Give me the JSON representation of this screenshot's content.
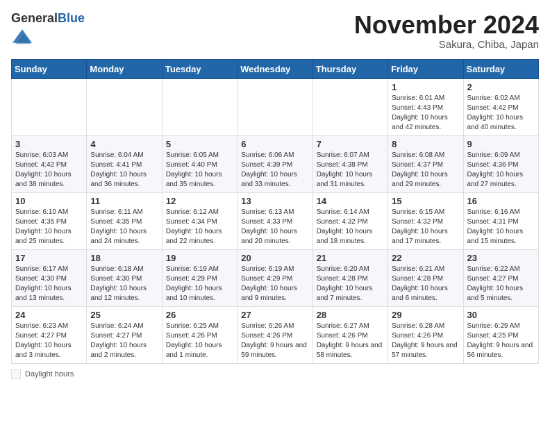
{
  "header": {
    "logo_general": "General",
    "logo_blue": "Blue",
    "month_title": "November 2024",
    "subtitle": "Sakura, Chiba, Japan"
  },
  "weekdays": [
    "Sunday",
    "Monday",
    "Tuesday",
    "Wednesday",
    "Thursday",
    "Friday",
    "Saturday"
  ],
  "footer": {
    "legend_label": "Daylight hours"
  },
  "weeks": [
    [
      {
        "day": "",
        "info": ""
      },
      {
        "day": "",
        "info": ""
      },
      {
        "day": "",
        "info": ""
      },
      {
        "day": "",
        "info": ""
      },
      {
        "day": "",
        "info": ""
      },
      {
        "day": "1",
        "info": "Sunrise: 6:01 AM\nSunset: 4:43 PM\nDaylight: 10 hours and 42 minutes."
      },
      {
        "day": "2",
        "info": "Sunrise: 6:02 AM\nSunset: 4:42 PM\nDaylight: 10 hours and 40 minutes."
      }
    ],
    [
      {
        "day": "3",
        "info": "Sunrise: 6:03 AM\nSunset: 4:42 PM\nDaylight: 10 hours and 38 minutes."
      },
      {
        "day": "4",
        "info": "Sunrise: 6:04 AM\nSunset: 4:41 PM\nDaylight: 10 hours and 36 minutes."
      },
      {
        "day": "5",
        "info": "Sunrise: 6:05 AM\nSunset: 4:40 PM\nDaylight: 10 hours and 35 minutes."
      },
      {
        "day": "6",
        "info": "Sunrise: 6:06 AM\nSunset: 4:39 PM\nDaylight: 10 hours and 33 minutes."
      },
      {
        "day": "7",
        "info": "Sunrise: 6:07 AM\nSunset: 4:38 PM\nDaylight: 10 hours and 31 minutes."
      },
      {
        "day": "8",
        "info": "Sunrise: 6:08 AM\nSunset: 4:37 PM\nDaylight: 10 hours and 29 minutes."
      },
      {
        "day": "9",
        "info": "Sunrise: 6:09 AM\nSunset: 4:36 PM\nDaylight: 10 hours and 27 minutes."
      }
    ],
    [
      {
        "day": "10",
        "info": "Sunrise: 6:10 AM\nSunset: 4:35 PM\nDaylight: 10 hours and 25 minutes."
      },
      {
        "day": "11",
        "info": "Sunrise: 6:11 AM\nSunset: 4:35 PM\nDaylight: 10 hours and 24 minutes."
      },
      {
        "day": "12",
        "info": "Sunrise: 6:12 AM\nSunset: 4:34 PM\nDaylight: 10 hours and 22 minutes."
      },
      {
        "day": "13",
        "info": "Sunrise: 6:13 AM\nSunset: 4:33 PM\nDaylight: 10 hours and 20 minutes."
      },
      {
        "day": "14",
        "info": "Sunrise: 6:14 AM\nSunset: 4:32 PM\nDaylight: 10 hours and 18 minutes."
      },
      {
        "day": "15",
        "info": "Sunrise: 6:15 AM\nSunset: 4:32 PM\nDaylight: 10 hours and 17 minutes."
      },
      {
        "day": "16",
        "info": "Sunrise: 6:16 AM\nSunset: 4:31 PM\nDaylight: 10 hours and 15 minutes."
      }
    ],
    [
      {
        "day": "17",
        "info": "Sunrise: 6:17 AM\nSunset: 4:30 PM\nDaylight: 10 hours and 13 minutes."
      },
      {
        "day": "18",
        "info": "Sunrise: 6:18 AM\nSunset: 4:30 PM\nDaylight: 10 hours and 12 minutes."
      },
      {
        "day": "19",
        "info": "Sunrise: 6:19 AM\nSunset: 4:29 PM\nDaylight: 10 hours and 10 minutes."
      },
      {
        "day": "20",
        "info": "Sunrise: 6:19 AM\nSunset: 4:29 PM\nDaylight: 10 hours and 9 minutes."
      },
      {
        "day": "21",
        "info": "Sunrise: 6:20 AM\nSunset: 4:28 PM\nDaylight: 10 hours and 7 minutes."
      },
      {
        "day": "22",
        "info": "Sunrise: 6:21 AM\nSunset: 4:28 PM\nDaylight: 10 hours and 6 minutes."
      },
      {
        "day": "23",
        "info": "Sunrise: 6:22 AM\nSunset: 4:27 PM\nDaylight: 10 hours and 5 minutes."
      }
    ],
    [
      {
        "day": "24",
        "info": "Sunrise: 6:23 AM\nSunset: 4:27 PM\nDaylight: 10 hours and 3 minutes."
      },
      {
        "day": "25",
        "info": "Sunrise: 6:24 AM\nSunset: 4:27 PM\nDaylight: 10 hours and 2 minutes."
      },
      {
        "day": "26",
        "info": "Sunrise: 6:25 AM\nSunset: 4:26 PM\nDaylight: 10 hours and 1 minute."
      },
      {
        "day": "27",
        "info": "Sunrise: 6:26 AM\nSunset: 4:26 PM\nDaylight: 9 hours and 59 minutes."
      },
      {
        "day": "28",
        "info": "Sunrise: 6:27 AM\nSunset: 4:26 PM\nDaylight: 9 hours and 58 minutes."
      },
      {
        "day": "29",
        "info": "Sunrise: 6:28 AM\nSunset: 4:26 PM\nDaylight: 9 hours and 57 minutes."
      },
      {
        "day": "30",
        "info": "Sunrise: 6:29 AM\nSunset: 4:25 PM\nDaylight: 9 hours and 56 minutes."
      }
    ]
  ]
}
